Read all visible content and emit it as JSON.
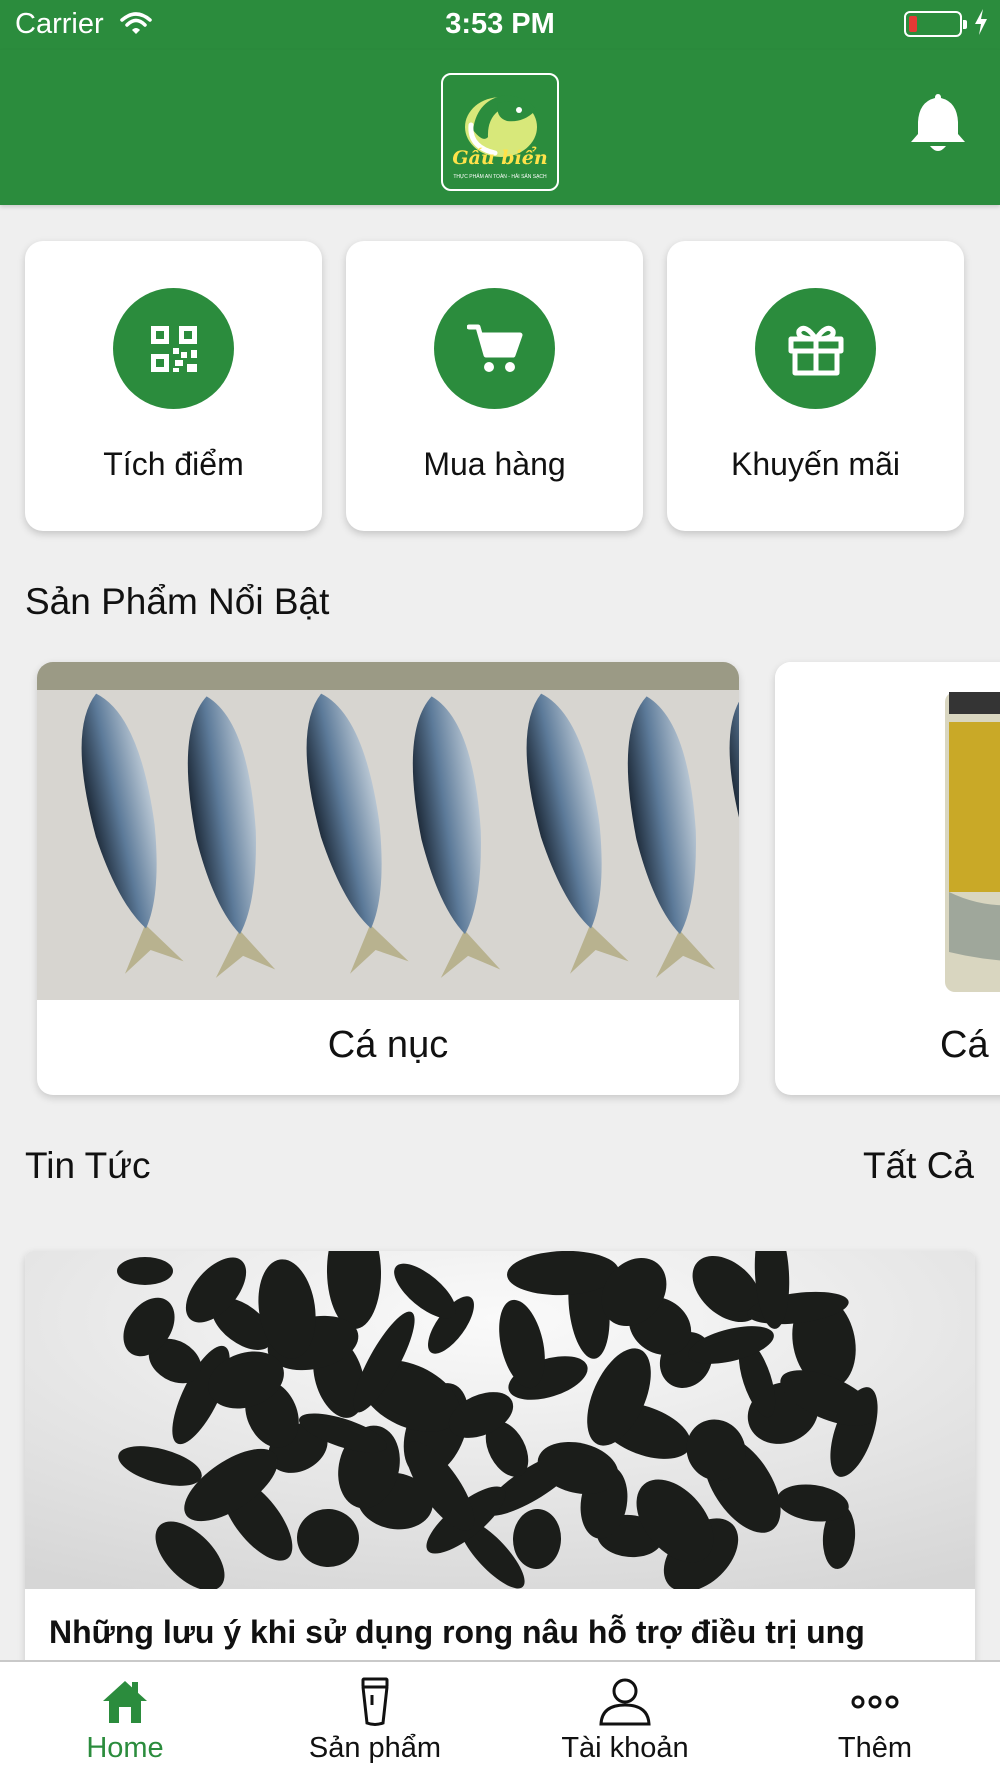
{
  "status_bar": {
    "carrier": "Carrier",
    "time": "3:53 PM",
    "battery_level": 0.15,
    "charging": true
  },
  "header": {
    "brand": "Gấu biển",
    "slogan": "THỰC PHẨM AN TOÀN - HẢI SẢN SẠCH",
    "brand_color": "#2b8c3d",
    "notification_icon": "bell-icon"
  },
  "quick_actions": [
    {
      "label": "Tích điểm",
      "icon": "qr-code-icon"
    },
    {
      "label": "Mua hàng",
      "icon": "cart-icon"
    },
    {
      "label": "Khuyến mãi",
      "icon": "gift-icon"
    }
  ],
  "featured": {
    "title": "Sản Phẩm Nổi Bật",
    "products": [
      {
        "name": "Cá nục"
      },
      {
        "name": "Cá"
      }
    ]
  },
  "news": {
    "title": "Tin Tức",
    "see_all": "Tất Cả",
    "articles": [
      {
        "title": "Những lưu ý khi sử dụng rong nâu hỗ trợ điều trị ung"
      }
    ]
  },
  "tab_bar": {
    "active_color": "#2b8c3d",
    "tabs": [
      {
        "label": "Home",
        "icon": "home-icon",
        "active": true
      },
      {
        "label": "Sản phẩm",
        "icon": "product-icon",
        "active": false
      },
      {
        "label": "Tài khoản",
        "icon": "user-icon",
        "active": false
      },
      {
        "label": "Thêm",
        "icon": "more-icon",
        "active": false
      }
    ]
  }
}
